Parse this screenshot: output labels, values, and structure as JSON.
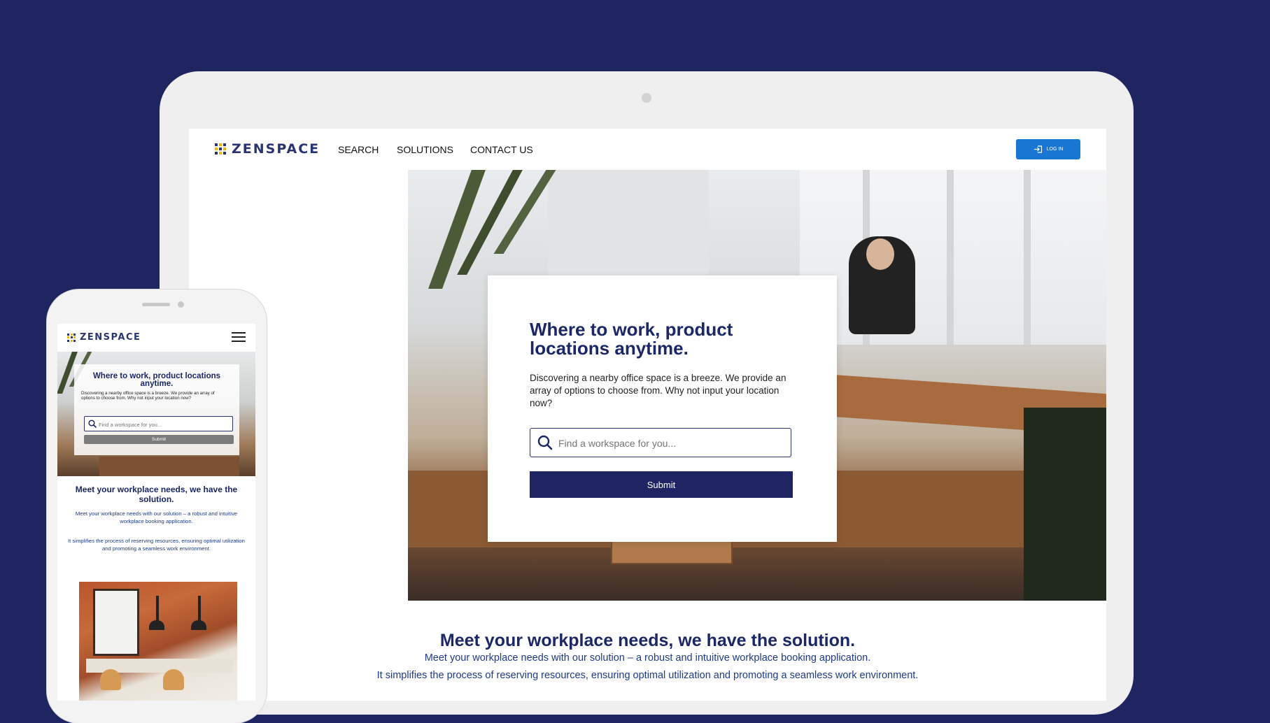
{
  "brand": {
    "name": "ZENSPACE",
    "dot_colors": [
      "#2a3470",
      "#f4b400",
      "#2a3470",
      "#f4b400",
      "#2a3470",
      "#f4b400",
      "#2a3470",
      "#f4b400",
      "#2a3470"
    ]
  },
  "colors": {
    "background": "#1f2560",
    "primary_navy": "#1f2563",
    "login_blue": "#1976d2",
    "heading": "#1b2766",
    "body_link": "#1f3a8a"
  },
  "desktop": {
    "nav": {
      "items": [
        "SEARCH",
        "SOLUTIONS",
        "CONTACT US"
      ],
      "login_label": "LOG IN",
      "login_icon": "login-icon"
    },
    "hero": {
      "title": "Where to work, product locations anytime.",
      "description": "Discovering a nearby office space is a breeze. We provide an array of options to choose from. Why not input your location now?",
      "search_placeholder": "Find a workspace for you...",
      "search_icon": "search-icon",
      "submit_label": "Submit"
    },
    "section": {
      "title": "Meet your workplace needs, we have the solution.",
      "p1": "Meet your workplace needs with our solution – a robust and intuitive workplace booking application.",
      "p2": "It simplifies the process of reserving resources, ensuring optimal utilization and promoting a seamless work environment."
    }
  },
  "mobile": {
    "menu_icon": "hamburger-icon",
    "hero": {
      "title": "Where to work, product locations anytime.",
      "description": "Discovering a nearby office space is a breeze. We provide an array of options to choose from. Why not input your location now?",
      "search_placeholder": "Find a workspace for you...",
      "submit_label": "Submit"
    },
    "section": {
      "title": "Meet your workplace needs, we have the solution.",
      "p1": "Meet your workplace needs with our solution – a robust and intuitive workplace booking application.",
      "p2": "It simplifies the process of reserving resources, ensuring optimal utilization and promoting a seamless work environment."
    }
  }
}
